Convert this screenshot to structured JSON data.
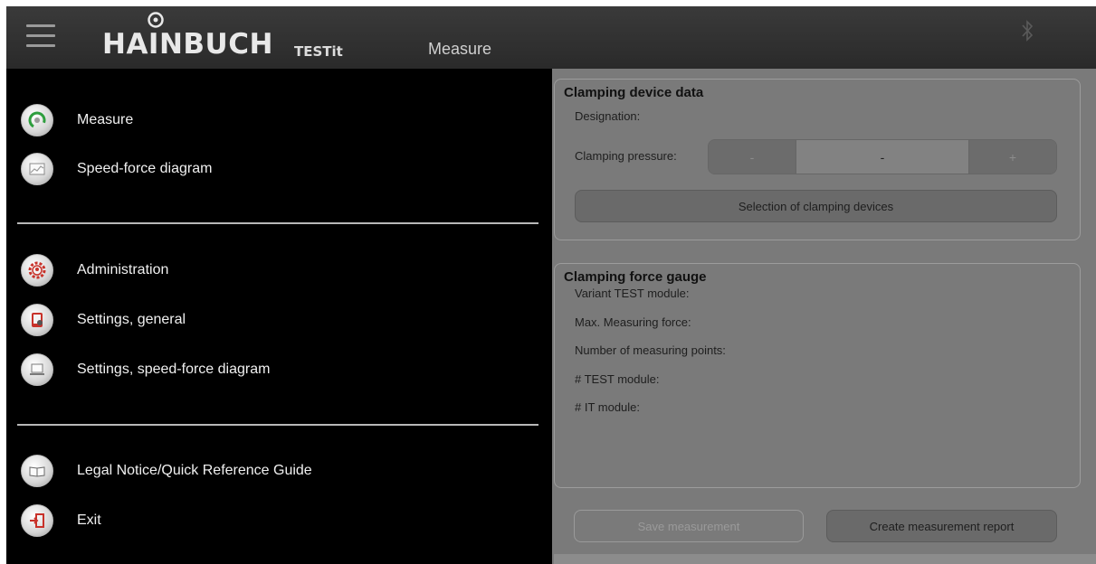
{
  "header": {
    "logo_text": "HAINBUCH",
    "product": "TESTit",
    "title": "Measure"
  },
  "menu": {
    "items": [
      {
        "label": "Measure",
        "icon": "gauge-icon"
      },
      {
        "label": "Speed-force diagram",
        "icon": "chart-icon"
      },
      {
        "label": "Administration",
        "icon": "admin-gear-icon"
      },
      {
        "label": "Settings, general",
        "icon": "settings-tablet-icon"
      },
      {
        "label": "Settings, speed-force diagram",
        "icon": "laptop-icon"
      },
      {
        "label": "Legal Notice/Quick Reference Guide",
        "icon": "book-icon"
      },
      {
        "label": "Exit",
        "icon": "exit-door-icon"
      }
    ]
  },
  "clamping_device": {
    "title": "Clamping device data",
    "designation_label": "Designation:",
    "pressure_label": "Clamping pressure:",
    "minus": "-",
    "value": "-",
    "plus": "+",
    "selection_button": "Selection of clamping devices"
  },
  "gauge": {
    "title": "Clamping force gauge",
    "fields": [
      "Variant TEST module:",
      "Max. Measuring force:",
      "Number of measuring points:",
      "# TEST module:",
      "# IT module:"
    ]
  },
  "actions": {
    "save": "Save measurement",
    "report": "Create measurement report"
  },
  "colors": {
    "menu_bg": "#000000",
    "header_bg": "#2f2f2f",
    "panel_bg": "#7a7a7a",
    "gauge_accent": "#2e9e3e",
    "icon_accent_red": "#c8322a"
  }
}
